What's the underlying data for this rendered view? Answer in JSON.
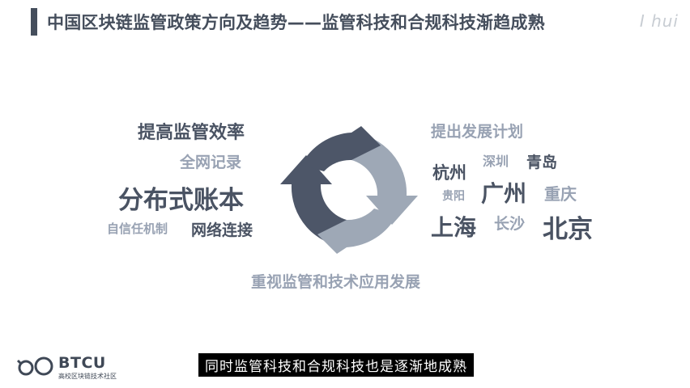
{
  "slide": {
    "title": "中国区块链监管政策方向及趋势——监管科技和合规科技渐趋成熟",
    "watermark": "I hui"
  },
  "left": {
    "improve_efficiency": "提高监管效率",
    "whole_network": "全网记录",
    "distributed_ledger": "分布式账本",
    "self_trust": "自信任机制",
    "network_connect": "网络连接"
  },
  "right": {
    "dev_plan": "提出发展计划",
    "cities": {
      "hangzhou": "杭州",
      "shenzhen": "深圳",
      "qingdao": "青岛",
      "guiyang": "贵阳",
      "guangzhou": "广州",
      "chongqing": "重庆",
      "shanghai": "上海",
      "changsha": "长沙",
      "beijing": "北京"
    }
  },
  "bottom_text": "重视监管和技术应用发展",
  "logo": {
    "name": "BTCU",
    "sub": "高校区块链技术社区"
  },
  "subtitle": "同时监管科技和合规科技也是逐渐地成熟",
  "colors": {
    "dark": "#4a5363",
    "light": "#98a2b3",
    "arrow_dark": "#4d5668",
    "arrow_light": "#9ea8b6"
  }
}
